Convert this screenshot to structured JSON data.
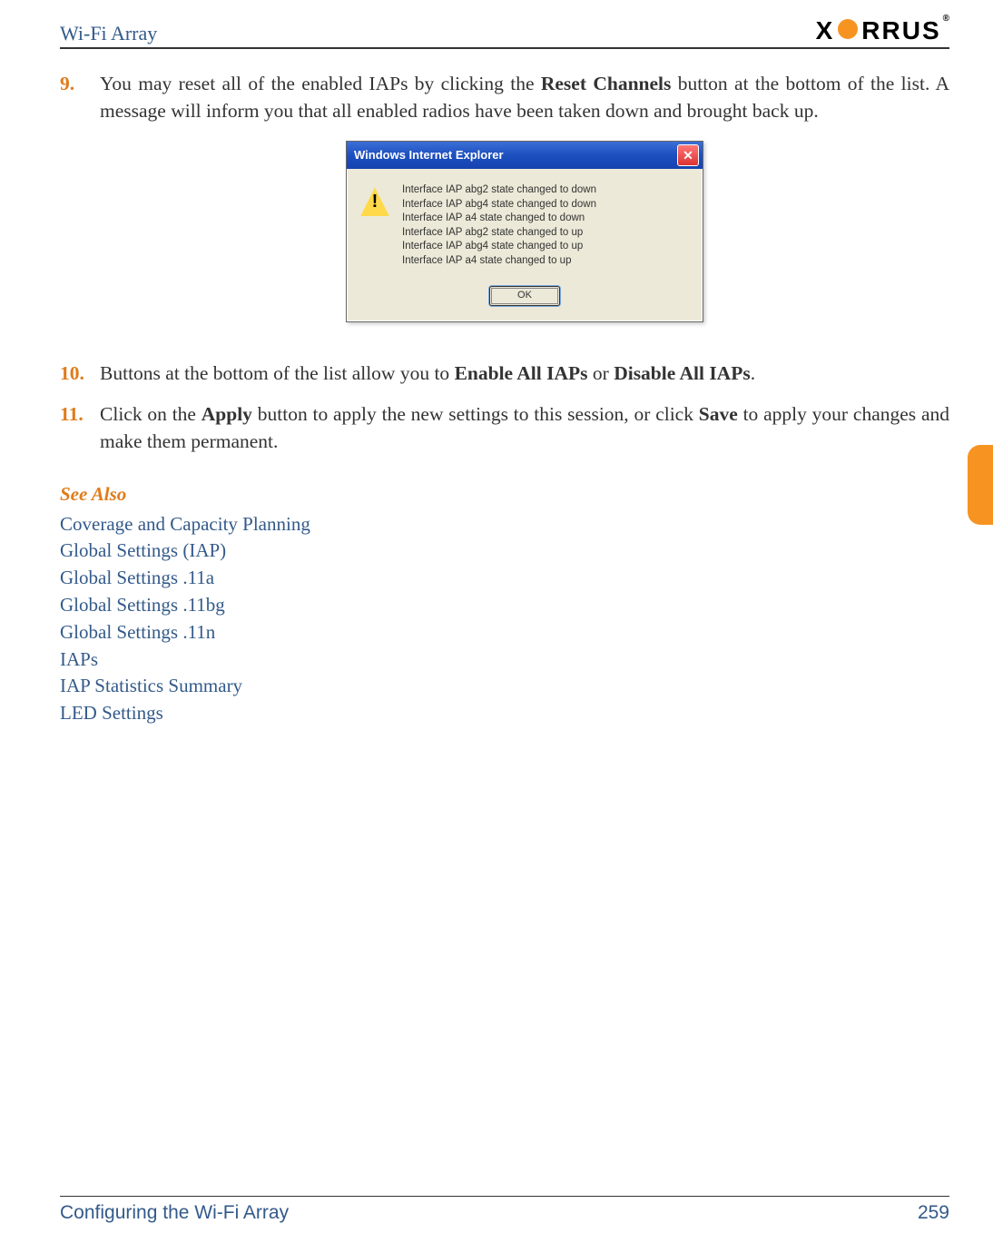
{
  "header": {
    "title": "Wi-Fi Array",
    "logo_text_before": "X",
    "logo_text_after": "RRUS",
    "logo_registered": "®"
  },
  "items": {
    "nine": {
      "num": "9.",
      "text_before_bold": "You may reset all of the enabled IAPs by clicking the ",
      "bold": "Reset Channels",
      "text_after_bold": " button at the bottom of the list. A message will inform you that all enabled radios have been taken down and brought back up."
    },
    "ten": {
      "num": "10.",
      "text_before_bold1": "Buttons at the bottom of the list allow you to ",
      "bold1": "Enable All IAPs",
      "text_mid": " or ",
      "bold2": "Disable All IAPs",
      "text_after": "."
    },
    "eleven": {
      "num": "11.",
      "text_before_bold1": "Click on the ",
      "bold1": "Apply",
      "text_mid1": " button to apply the new settings to this session, or click ",
      "bold2": "Save",
      "text_after": " to apply your changes and make them permanent."
    }
  },
  "dialog": {
    "title": "Windows Internet Explorer",
    "lines": [
      "Interface IAP abg2 state changed to down",
      "Interface IAP abg4 state changed to down",
      "Interface IAP a4 state changed to down",
      "Interface IAP abg2 state changed to up",
      "Interface IAP abg4 state changed to up",
      "Interface IAP a4 state changed to up"
    ],
    "ok": "OK"
  },
  "see_also": {
    "heading": "See Also",
    "links": [
      "Coverage and Capacity Planning",
      "Global Settings (IAP)",
      "Global Settings .11a",
      "Global Settings .11bg",
      "Global Settings .11n",
      "IAPs",
      "IAP Statistics Summary",
      "LED Settings"
    ]
  },
  "footer": {
    "left": "Configuring the Wi-Fi Array",
    "right": "259"
  }
}
